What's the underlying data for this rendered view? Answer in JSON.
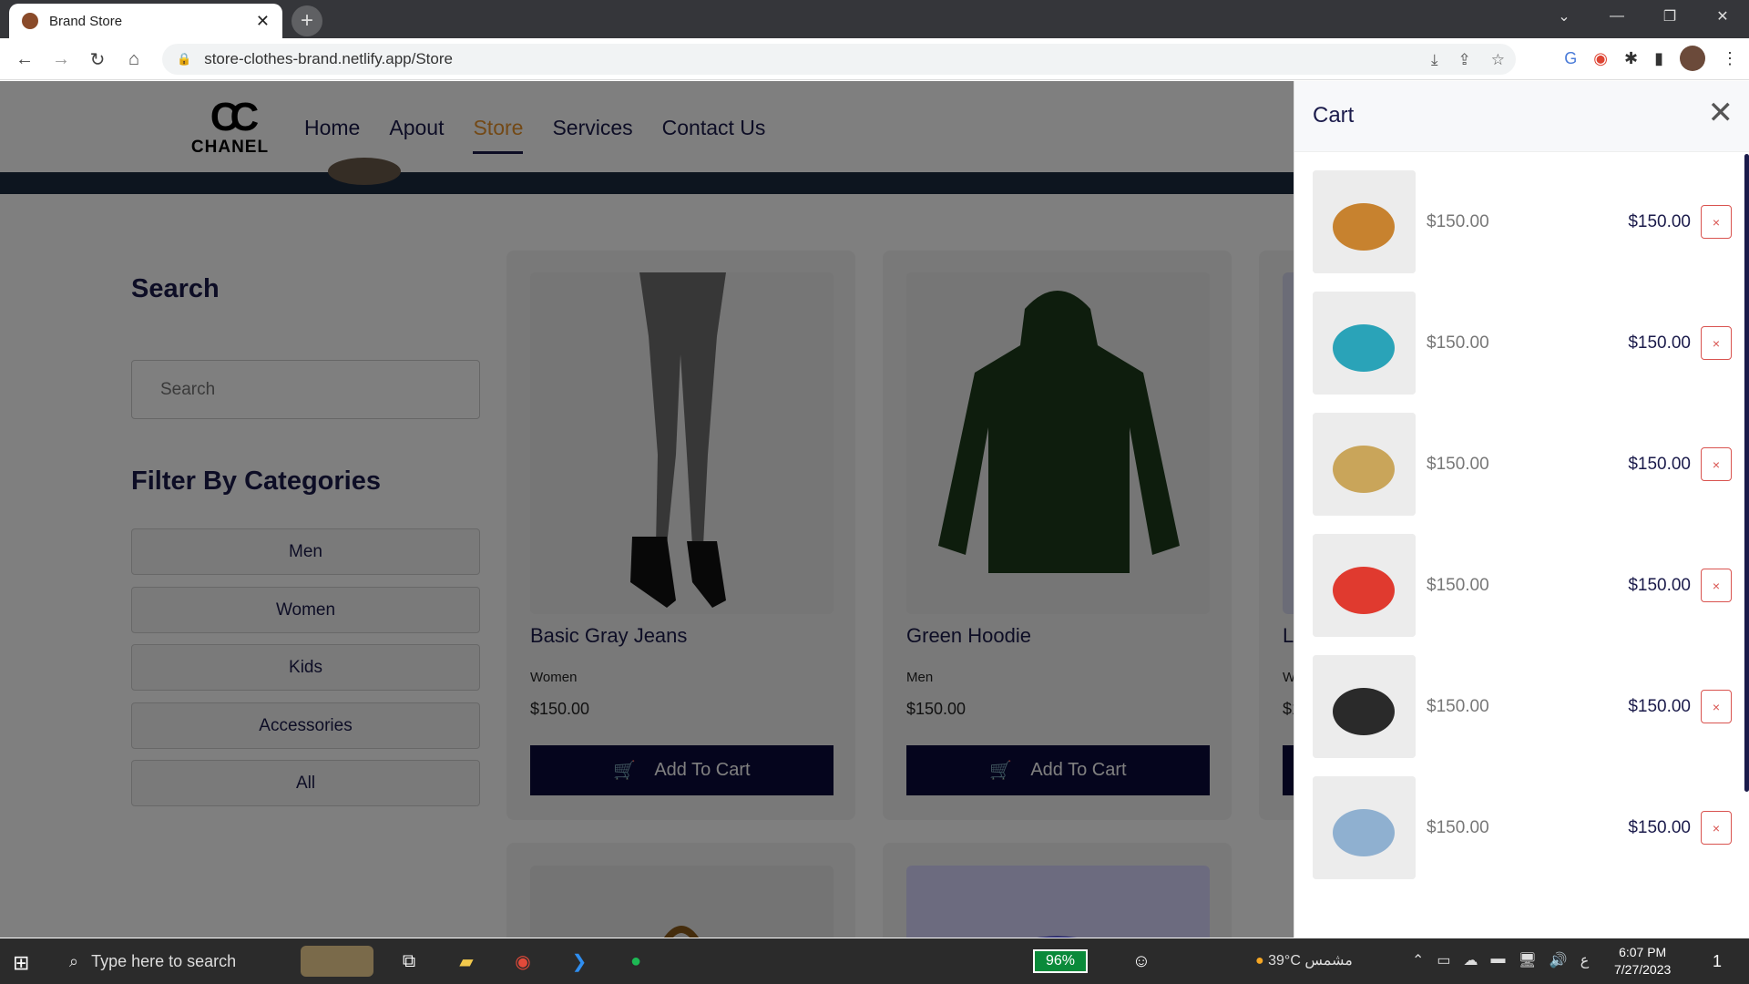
{
  "browser": {
    "tab_title": "Brand Store",
    "url": "store-clothes-brand.netlify.app/Store"
  },
  "site": {
    "logo_text": "CHANEL",
    "nav": [
      "Home",
      "Apout",
      "Store",
      "Services",
      "Contact Us"
    ],
    "active_nav": "Store"
  },
  "sidebar": {
    "search_title": "Search",
    "search_placeholder": "Search",
    "filter_title": "Filter By Categories",
    "categories": [
      "Men",
      "Women",
      "Kids",
      "Accessories",
      "All"
    ]
  },
  "products": [
    {
      "name": "Basic Gray Jeans",
      "category": "Women",
      "price": "$150.00",
      "button": "Add To Cart"
    },
    {
      "name": "Green Hoodie",
      "category": "Men",
      "price": "$150.00",
      "button": "Add To Cart"
    },
    {
      "name": "L",
      "category": "W",
      "price": "$1"
    }
  ],
  "cart": {
    "title": "Cart",
    "items": [
      {
        "unit_price": "$150.00",
        "total": "$150.00",
        "remove": "×",
        "thumb_color": "#c7822f"
      },
      {
        "unit_price": "$150.00",
        "total": "$150.00",
        "remove": "×",
        "thumb_color": "#2aa3b8"
      },
      {
        "unit_price": "$150.00",
        "total": "$150.00",
        "remove": "×",
        "thumb_color": "#c9a55a"
      },
      {
        "unit_price": "$150.00",
        "total": "$150.00",
        "remove": "×",
        "thumb_color": "#e03a2f"
      },
      {
        "unit_price": "$150.00",
        "total": "$150.00",
        "remove": "×",
        "thumb_color": "#2a2a2a"
      },
      {
        "unit_price": "$150.00",
        "total": "$150.00",
        "remove": "×",
        "thumb_color": "#8fb0d0"
      }
    ]
  },
  "taskbar": {
    "search_placeholder": "Type here to search",
    "battery": "96%",
    "weather": "39°C مشمس",
    "lang": "ع",
    "time": "6:07 PM",
    "date": "7/27/2023",
    "notifications": "1"
  },
  "colors": {
    "accent": "#e6932c",
    "navy": "#1b1b4b",
    "button_bg": "#0b0a3a",
    "remove": "#d9534f"
  }
}
